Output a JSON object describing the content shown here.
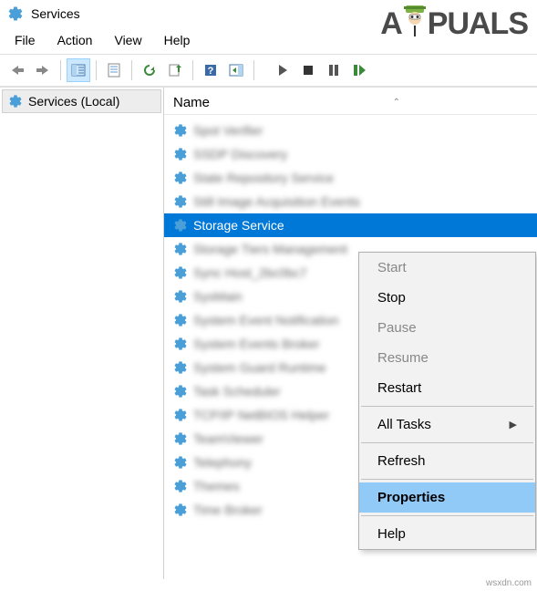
{
  "window": {
    "title": "Services"
  },
  "menu": {
    "file": "File",
    "action": "Action",
    "view": "View",
    "help": "Help"
  },
  "sidebar": {
    "label": "Services (Local)"
  },
  "column": {
    "name": "Name"
  },
  "logo": {
    "text_before": "A",
    "text_after": "PUALS"
  },
  "rows": {
    "r0": "Spot Verifier",
    "r1": "SSDP Discovery",
    "r2": "State Repository Service",
    "r3": "Still Image Acquisition Events",
    "r4": "Storage Service",
    "r5": "Storage Tiers Management",
    "r6": "Sync Host_2bc0bc7",
    "r7": "SysMain",
    "r8": "System Event Notification",
    "r9": "System Events Broker",
    "r10": "System Guard Runtime",
    "r11": "Task Scheduler",
    "r12": "TCP/IP NetBIOS Helper",
    "r13": "TeamViewer",
    "r14": "Telephony",
    "r15": "Themes",
    "r16": "Time Broker"
  },
  "context_menu": {
    "start": "Start",
    "stop": "Stop",
    "pause": "Pause",
    "resume": "Resume",
    "restart": "Restart",
    "all_tasks": "All Tasks",
    "refresh": "Refresh",
    "properties": "Properties",
    "help": "Help"
  },
  "attribution": "wsxdn.com"
}
